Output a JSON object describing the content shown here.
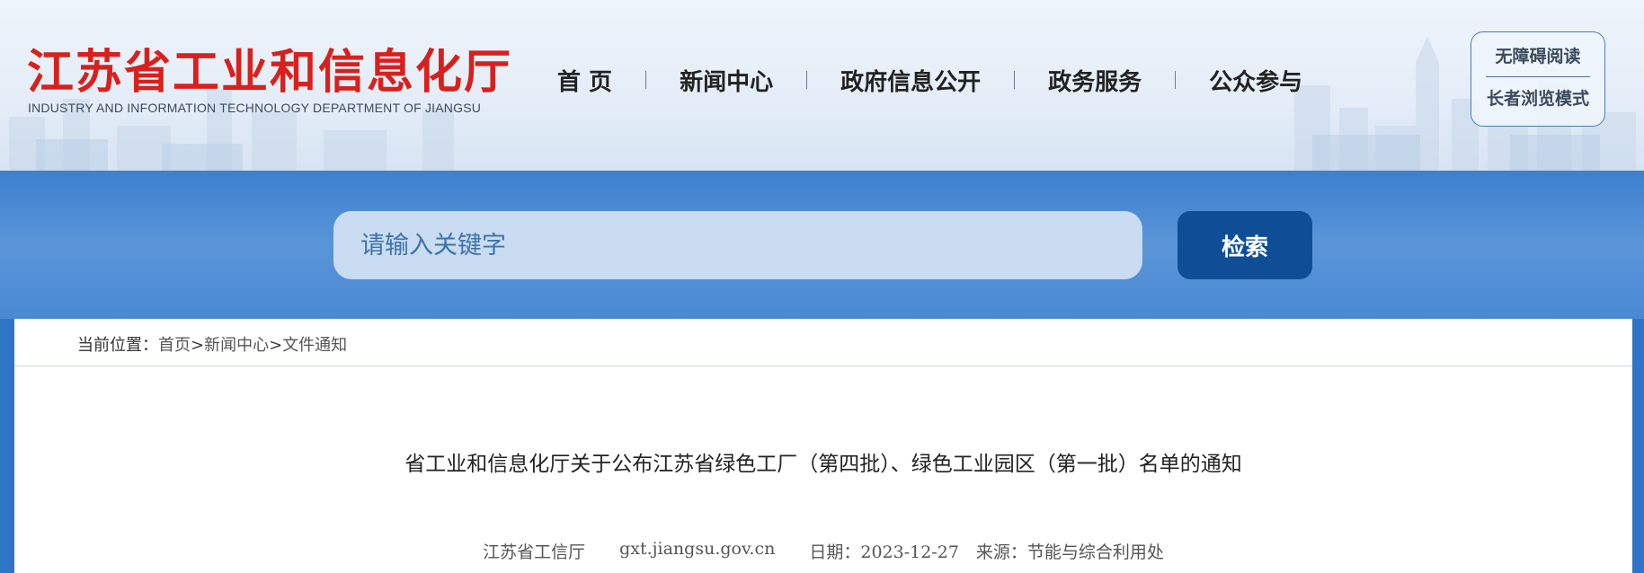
{
  "header": {
    "logo_cn": "江苏省工业和信息化厅",
    "logo_en": "INDUSTRY AND INFORMATION TECHNOLOGY DEPARTMENT OF JIANGSU",
    "nav": [
      "首 页",
      "新闻中心",
      "政府信息公开",
      "政务服务",
      "公众参与"
    ],
    "accessibility": {
      "barrier_free": "无障碍阅读",
      "elder_mode": "长者浏览模式"
    }
  },
  "search": {
    "placeholder": "请输入关键字",
    "button_label": "检索"
  },
  "breadcrumb": {
    "prefix": "当前位置：",
    "items": [
      "首页",
      "新闻中心",
      "文件通知"
    ],
    "separator": ">"
  },
  "article": {
    "title": "省工业和信息化厅关于公布江苏省绿色工厂（第四批）、绿色工业园区（第一批）名单的通知",
    "publisher": "江苏省工信厅",
    "site": "gxt.jiangsu.gov.cn",
    "date": "日期：2023-12-27",
    "source": "来源：节能与综合利用处"
  },
  "colors": {
    "brand_red": "#d9201e",
    "band_blue": "#4a89d2",
    "button_blue": "#0f4e97"
  }
}
